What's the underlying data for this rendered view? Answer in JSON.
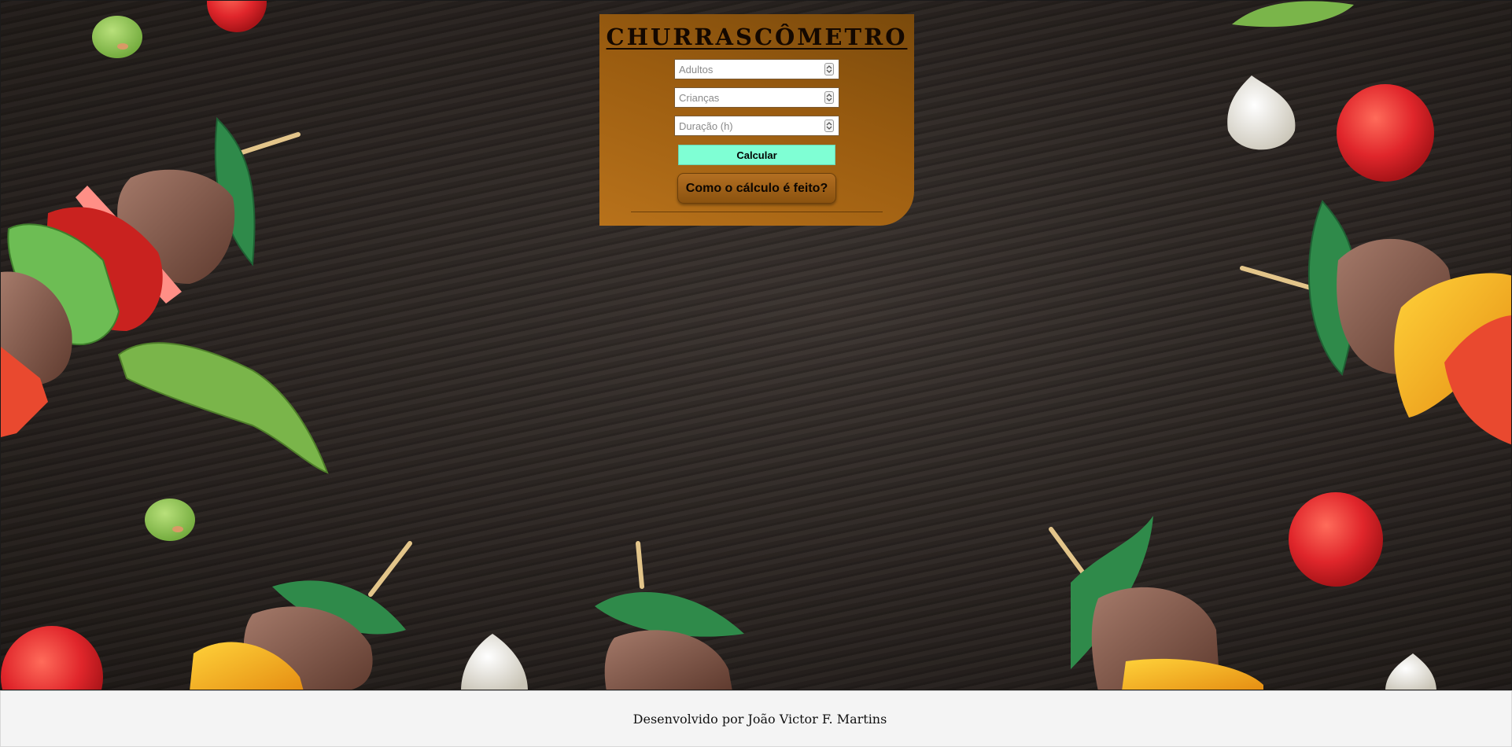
{
  "app": {
    "title": "CHURRASCÔMETRO"
  },
  "form": {
    "fields": [
      {
        "placeholder": "Adultos",
        "value": "",
        "type": "number"
      },
      {
        "placeholder": "Crianças",
        "value": "",
        "type": "number"
      },
      {
        "placeholder": "Duração (h)",
        "value": "",
        "type": "number"
      }
    ],
    "calculate_label": "Calcular",
    "how_label": "Como o cálculo é feito?"
  },
  "footer": {
    "credit": "Desenvolvido por João Victor F. Martins"
  },
  "colors": {
    "panel": "#9a5c10",
    "calculate_button": "#7fffd4",
    "background": "#2b2623",
    "footer": "#f4f4f4"
  },
  "icons": [
    "tomato-icon",
    "garlic-icon",
    "bean-icon",
    "kebab-skewer-icon",
    "pea-pod-icon",
    "spinner-arrows-icon"
  ]
}
